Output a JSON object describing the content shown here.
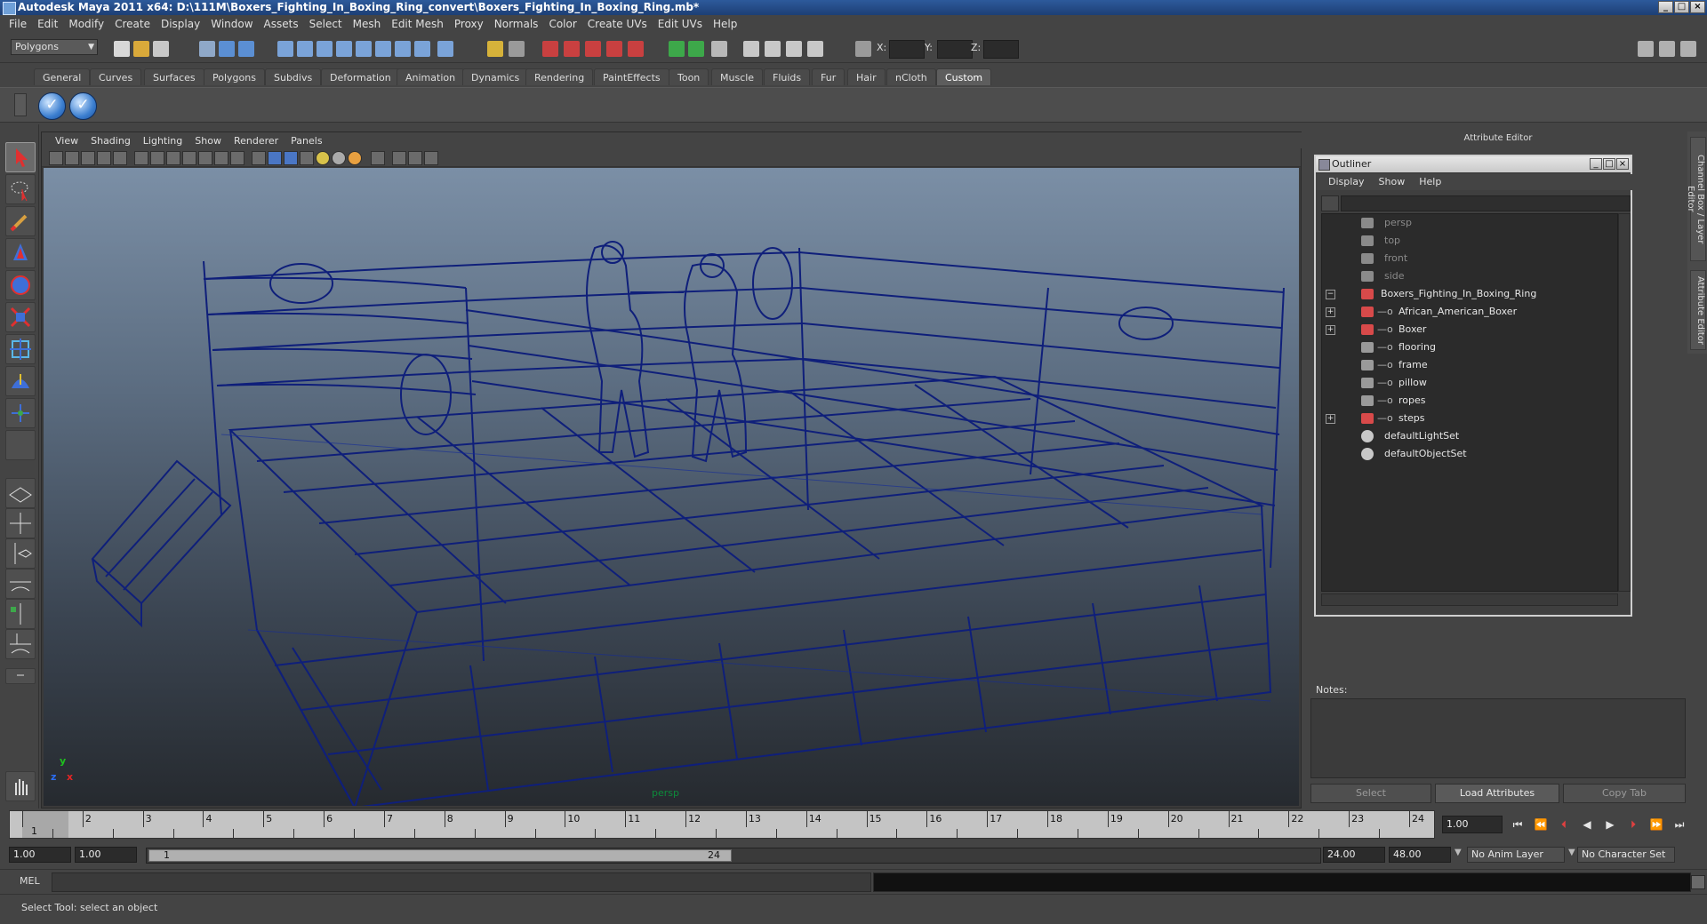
{
  "window": {
    "title": "Autodesk Maya 2011 x64: D:\\111M\\Boxers_Fighting_In_Boxing_Ring_convert\\Boxers_Fighting_In_Boxing_Ring.mb*",
    "minimize": "_",
    "maximize": "□",
    "close": "×"
  },
  "menubar": [
    "File",
    "Edit",
    "Modify",
    "Create",
    "Display",
    "Window",
    "Assets",
    "Select",
    "Mesh",
    "Edit Mesh",
    "Proxy",
    "Normals",
    "Color",
    "Create UVs",
    "Edit UVs",
    "Help"
  ],
  "statusline": {
    "mode": "Polygons",
    "x_label": "X:",
    "y_label": "Y:",
    "z_label": "Z:"
  },
  "shelf_tabs": [
    "General",
    "Curves",
    "Surfaces",
    "Polygons",
    "Subdivs",
    "Deformation",
    "Animation",
    "Dynamics",
    "Rendering",
    "PaintEffects",
    "Toon",
    "Muscle",
    "Fluids",
    "Fur",
    "Hair",
    "nCloth",
    "Custom"
  ],
  "active_shelf_tab": "Custom",
  "shelf_buttons": [
    "✓",
    "✓"
  ],
  "viewport": {
    "menus": [
      "View",
      "Shading",
      "Lighting",
      "Show",
      "Renderer",
      "Panels"
    ],
    "camera": "persp",
    "axis_x": "x",
    "axis_y": "y",
    "axis_z": "z"
  },
  "attribute_editor": {
    "header": "Attribute Editor",
    "side_tabs": [
      "Channel Box / Layer Editor",
      "Attribute Editor"
    ],
    "notes_label": "Notes:",
    "buttons": {
      "select": "Select",
      "load": "Load Attributes",
      "copy": "Copy Tab"
    }
  },
  "outliner": {
    "title": "Outliner",
    "menus": [
      "Display",
      "Show",
      "Help"
    ],
    "rows": [
      {
        "label": "persp",
        "dim": true
      },
      {
        "label": "top",
        "dim": true
      },
      {
        "label": "front",
        "dim": true
      },
      {
        "label": "side",
        "dim": true
      },
      {
        "label": "Boxers_Fighting_In_Boxing_Ring",
        "dim": false
      },
      {
        "label": "African_American_Boxer",
        "dim": false
      },
      {
        "label": "Boxer",
        "dim": false
      },
      {
        "label": "flooring",
        "dim": false
      },
      {
        "label": "frame",
        "dim": false
      },
      {
        "label": "pillow",
        "dim": false
      },
      {
        "label": "ropes",
        "dim": false
      },
      {
        "label": "steps",
        "dim": false
      },
      {
        "label": "defaultLightSet",
        "dim": false
      },
      {
        "label": "defaultObjectSet",
        "dim": false
      }
    ]
  },
  "timeline": {
    "ticks": [
      "1",
      "2",
      "3",
      "4",
      "5",
      "6",
      "7",
      "8",
      "9",
      "10",
      "11",
      "12",
      "13",
      "14",
      "15",
      "16",
      "17",
      "18",
      "19",
      "20",
      "21",
      "22",
      "23",
      "24"
    ],
    "current_marker": "1",
    "current_frame": "1.00"
  },
  "range": {
    "start": "1.00",
    "playback_start": "1.00",
    "handle_start": "1",
    "handle_end": "24",
    "playback_end": "24.00",
    "end": "48.00",
    "anim_layer": "No Anim Layer",
    "character_set": "No Character Set"
  },
  "command": {
    "label": "MEL"
  },
  "helpline": "Select Tool: select an object",
  "colors": {
    "wireframe": "#0f1f7a",
    "accent": "#3c7fd0"
  }
}
